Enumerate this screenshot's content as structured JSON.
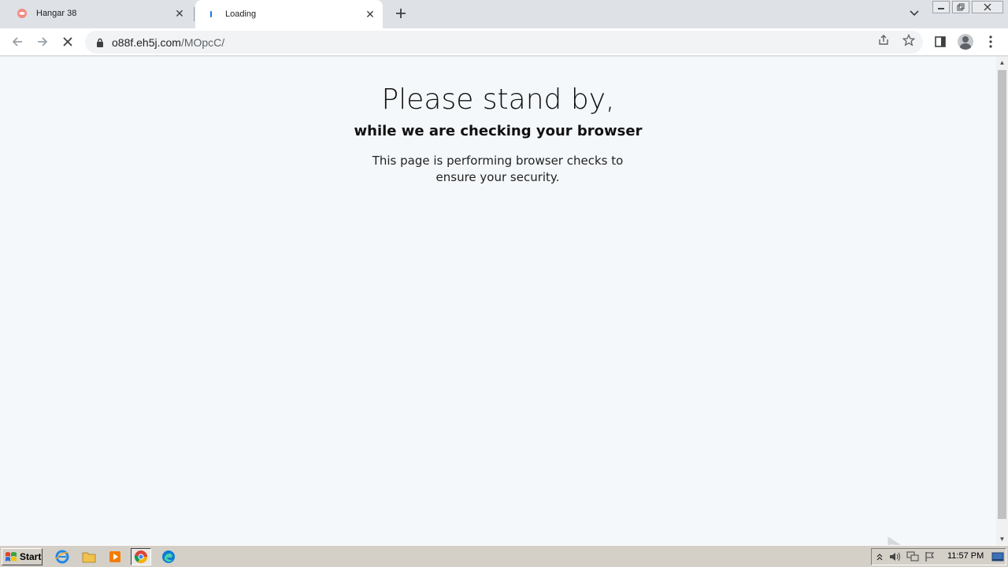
{
  "browser": {
    "tabs": [
      {
        "title": "Hangar 38",
        "active": false
      },
      {
        "title": "Loading",
        "active": true
      }
    ],
    "address": {
      "host": "o88f.eh5j.com",
      "path": "/MOpcC/"
    }
  },
  "page": {
    "heading": "Please stand by,",
    "subheading": "while we are checking your browser",
    "body": "This page is performing browser checks to ensure your security."
  },
  "taskbar": {
    "start_label": "Start",
    "clock": "11:57 PM"
  },
  "colors": {
    "page_bg": "#f5f8fa",
    "tabstrip_bg": "#dee1e6",
    "loading_accent": "#1a73e8"
  }
}
